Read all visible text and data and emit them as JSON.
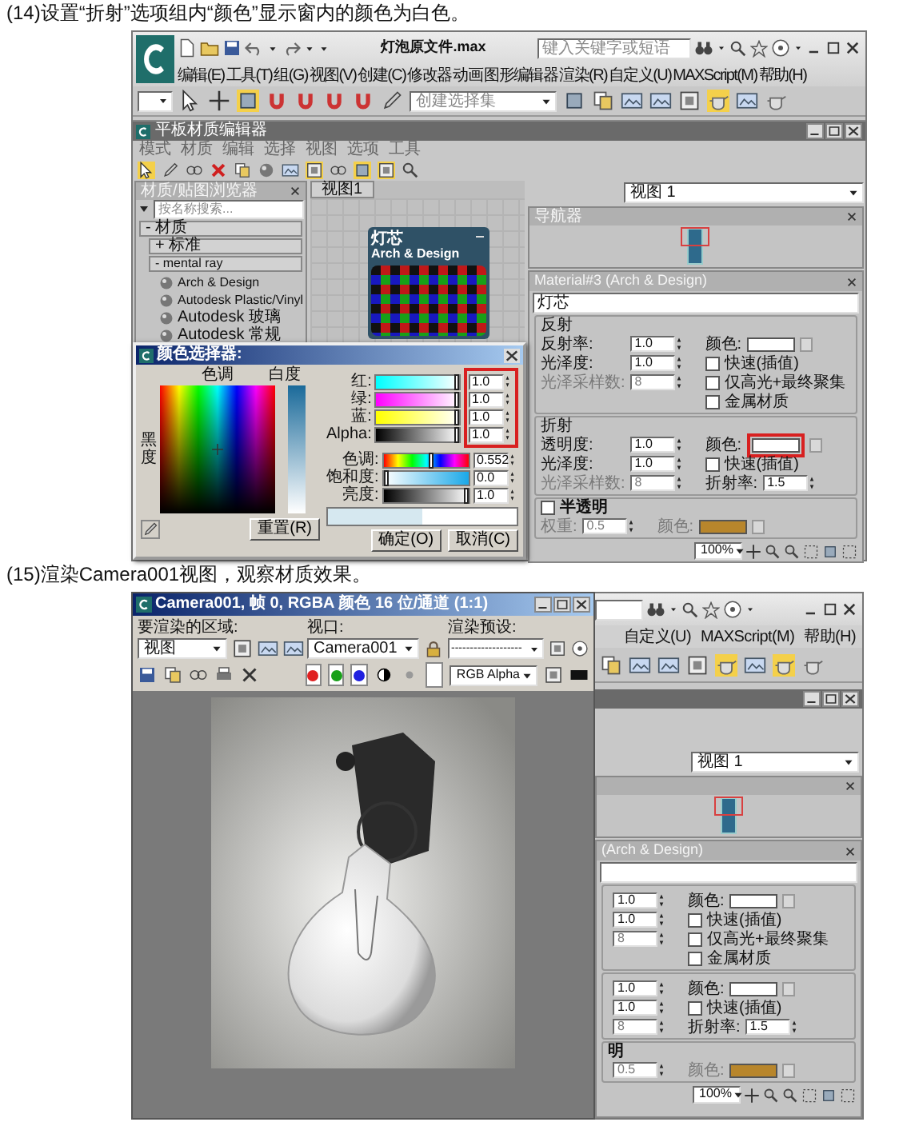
{
  "first_step": {
    "caption": "(14)设置“折射”选项组内“颜色”显示窗内的颜色为白色。",
    "app": {
      "title": "灯泡原文件.max",
      "search": {
        "placeholder": "键入关键字或短语"
      },
      "menu": [
        "编辑(E)",
        "工具(T)",
        "组(G)",
        "视图(V)",
        "创建(C)",
        "修改器",
        "动画",
        "图形编辑器",
        "渲染(R)",
        "自定义(U)",
        "MAXScript(M)",
        "帮助(H)"
      ],
      "selection_set": {
        "placeholder": "创建选择集"
      },
      "editor": {
        "title": "平板材质编辑器",
        "menu": [
          "模式",
          "材质",
          "编辑",
          "选择",
          "视图",
          "选项",
          "工具"
        ],
        "browser": {
          "title": "材质/贴图浏览器",
          "search": {
            "placeholder": "按名称搜索..."
          },
          "tree": [
            {
              "kind": "category",
              "label": "- 材质",
              "children": [
                {
                  "kind": "category",
                  "label": "+ 标准"
                },
                {
                  "kind": "category",
                  "label": "- mental ray",
                  "children": [
                    {
                      "kind": "material",
                      "label": "Arch & Design"
                    },
                    {
                      "kind": "material",
                      "label": "Autodesk Plastic/Vinyl"
                    },
                    {
                      "kind": "material",
                      "label": "Autodesk 玻璃"
                    },
                    {
                      "kind": "material",
                      "label": "Autodesk 常规"
                    }
                  ]
                }
              ]
            }
          ]
        },
        "view_tab": "视图1",
        "node": {
          "title": "灯芯",
          "type": "Arch & Design"
        },
        "view_select": "视图 1",
        "navigator": {
          "title": "导航器"
        },
        "params": {
          "title": "Material#3 (Arch & Design)",
          "name": "灯芯",
          "groups": [
            {
              "title": "反射",
              "left": [
                {
                  "label": "反射率:",
                  "value": "1.0",
                  "disabled": false
                },
                {
                  "label": "光泽度:",
                  "value": "1.0",
                  "disabled": false
                },
                {
                  "label": "光泽采样数:",
                  "value": "8",
                  "disabled": true
                }
              ],
              "right": [
                {
                  "kind": "color",
                  "label": "颜色:",
                  "color": "#ffffff",
                  "disabled": false,
                  "highlighted": false
                },
                {
                  "kind": "checkbox",
                  "label": "快速(插值)",
                  "checked": false,
                  "disabled": false
                },
                {
                  "kind": "checkbox",
                  "label": "仅高光+最终聚集",
                  "checked": false,
                  "disabled": false
                },
                {
                  "kind": "checkbox",
                  "label": "金属材质",
                  "checked": false,
                  "disabled": false
                }
              ]
            },
            {
              "title": "折射",
              "left": [
                {
                  "label": "透明度:",
                  "value": "1.0",
                  "disabled": false
                },
                {
                  "label": "光泽度:",
                  "value": "1.0",
                  "disabled": false
                },
                {
                  "label": "光泽采样数:",
                  "value": "8",
                  "disabled": true
                }
              ],
              "right": [
                {
                  "kind": "color",
                  "label": "颜色:",
                  "color": "#ffffff",
                  "disabled": false,
                  "highlighted": true
                },
                {
                  "kind": "checkbox",
                  "label": "快速(插值)",
                  "checked": false,
                  "disabled": false
                },
                {
                  "kind": "spinner",
                  "label": "折射率:",
                  "value": "1.5",
                  "disabled": false
                }
              ]
            }
          ],
          "translucency": {
            "label": "半透明",
            "checked": false,
            "left": [
              {
                "label": "权重:",
                "value": "0.5",
                "disabled": true
              }
            ],
            "right": [
              {
                "kind": "color",
                "label": "颜色:",
                "color": "#b8862c",
                "disabled": true,
                "highlighted": false
              }
            ]
          }
        },
        "zoom": "100%"
      }
    },
    "color_picker": {
      "title": "颜色选择器:",
      "hue_label": "色调",
      "whiteness_label": "白度",
      "blackness_label": "黑度",
      "highlighted": true,
      "rgba": [
        {
          "kind": "red",
          "label": "红:",
          "value": "1.0",
          "level": 1
        },
        {
          "kind": "green",
          "label": "绿:",
          "value": "1.0",
          "level": 1
        },
        {
          "kind": "blue",
          "label": "蓝:",
          "value": "1.0",
          "level": 1
        },
        {
          "kind": "alpha",
          "label": "Alpha:",
          "value": "1.0",
          "level": 1
        }
      ],
      "hsv": [
        {
          "kind": "hue",
          "label": "色调:",
          "value": "0.552",
          "level": 0.552
        },
        {
          "kind": "saturation",
          "label": "饱和度:",
          "value": "0.0",
          "level": 0
        },
        {
          "kind": "value",
          "label": "亮度:",
          "value": "1.0",
          "level": 1
        }
      ],
      "preview": [
        {
          "color": "#d6e8f0"
        },
        {
          "color": "#ffffff"
        }
      ],
      "reset": "重置(R)",
      "ok": "确定(O)",
      "cancel": "取消(C)"
    }
  },
  "second_step": {
    "caption": "(15)渲染Camera001视图，观察材质效果。",
    "render": {
      "title": "Camera001, 帧 0, RGBA 颜色 16 位/通道 (1:1)",
      "area": {
        "label": "要渲染的区域:",
        "value": "视图"
      },
      "viewport": {
        "label": "视口:",
        "value": "Camera001"
      },
      "preset": {
        "label": "渲染预设:",
        "value": "-------------------"
      },
      "channels": [
        {
          "color": "#e02020"
        },
        {
          "color": "#18a018"
        },
        {
          "color": "#2020e0"
        }
      ],
      "swatch": {
        "color": "#ffffff"
      },
      "display": "RGB Alpha"
    },
    "app": {
      "menu": [
        "自定义(U)",
        "MAXScript(M)",
        "帮助(H)"
      ],
      "view_select": "视图 1",
      "params": {
        "title": "(Arch & Design)",
        "groups": [
          {
            "left": [
              {
                "value": "1.0",
                "disabled": false
              },
              {
                "value": "1.0",
                "disabled": false
              },
              {
                "value": "8",
                "disabled": true
              }
            ],
            "right": [
              {
                "kind": "color",
                "label": "颜色:",
                "color": "#ffffff",
                "disabled": false,
                "highlighted": false
              },
              {
                "kind": "checkbox",
                "label": "快速(插值)",
                "checked": false,
                "disabled": false
              },
              {
                "kind": "checkbox",
                "label": "仅高光+最终聚集",
                "checked": false,
                "disabled": false
              },
              {
                "kind": "checkbox",
                "label": "金属材质",
                "checked": false,
                "disabled": false
              }
            ]
          },
          {
            "left": [
              {
                "value": "1.0",
                "disabled": false
              },
              {
                "value": "1.0",
                "disabled": false
              },
              {
                "value": "8",
                "disabled": true
              }
            ],
            "right": [
              {
                "kind": "color",
                "label": "颜色:",
                "color": "#ffffff",
                "disabled": false,
                "highlighted": false
              },
              {
                "kind": "checkbox",
                "label": "快速(插值)",
                "checked": false,
                "disabled": false
              },
              {
                "kind": "spinner",
                "label": "折射率:",
                "value": "1.5",
                "disabled": false
              }
            ]
          }
        ],
        "translucency": {
          "label": "明",
          "left": [
            {
              "value": "0.5",
              "disabled": true
            }
          ],
          "right": [
            {
              "kind": "color",
              "label": "颜色:",
              "color": "#b8862c",
              "disabled": true,
              "highlighted": false
            }
          ]
        }
      },
      "zoom": "100%"
    }
  }
}
